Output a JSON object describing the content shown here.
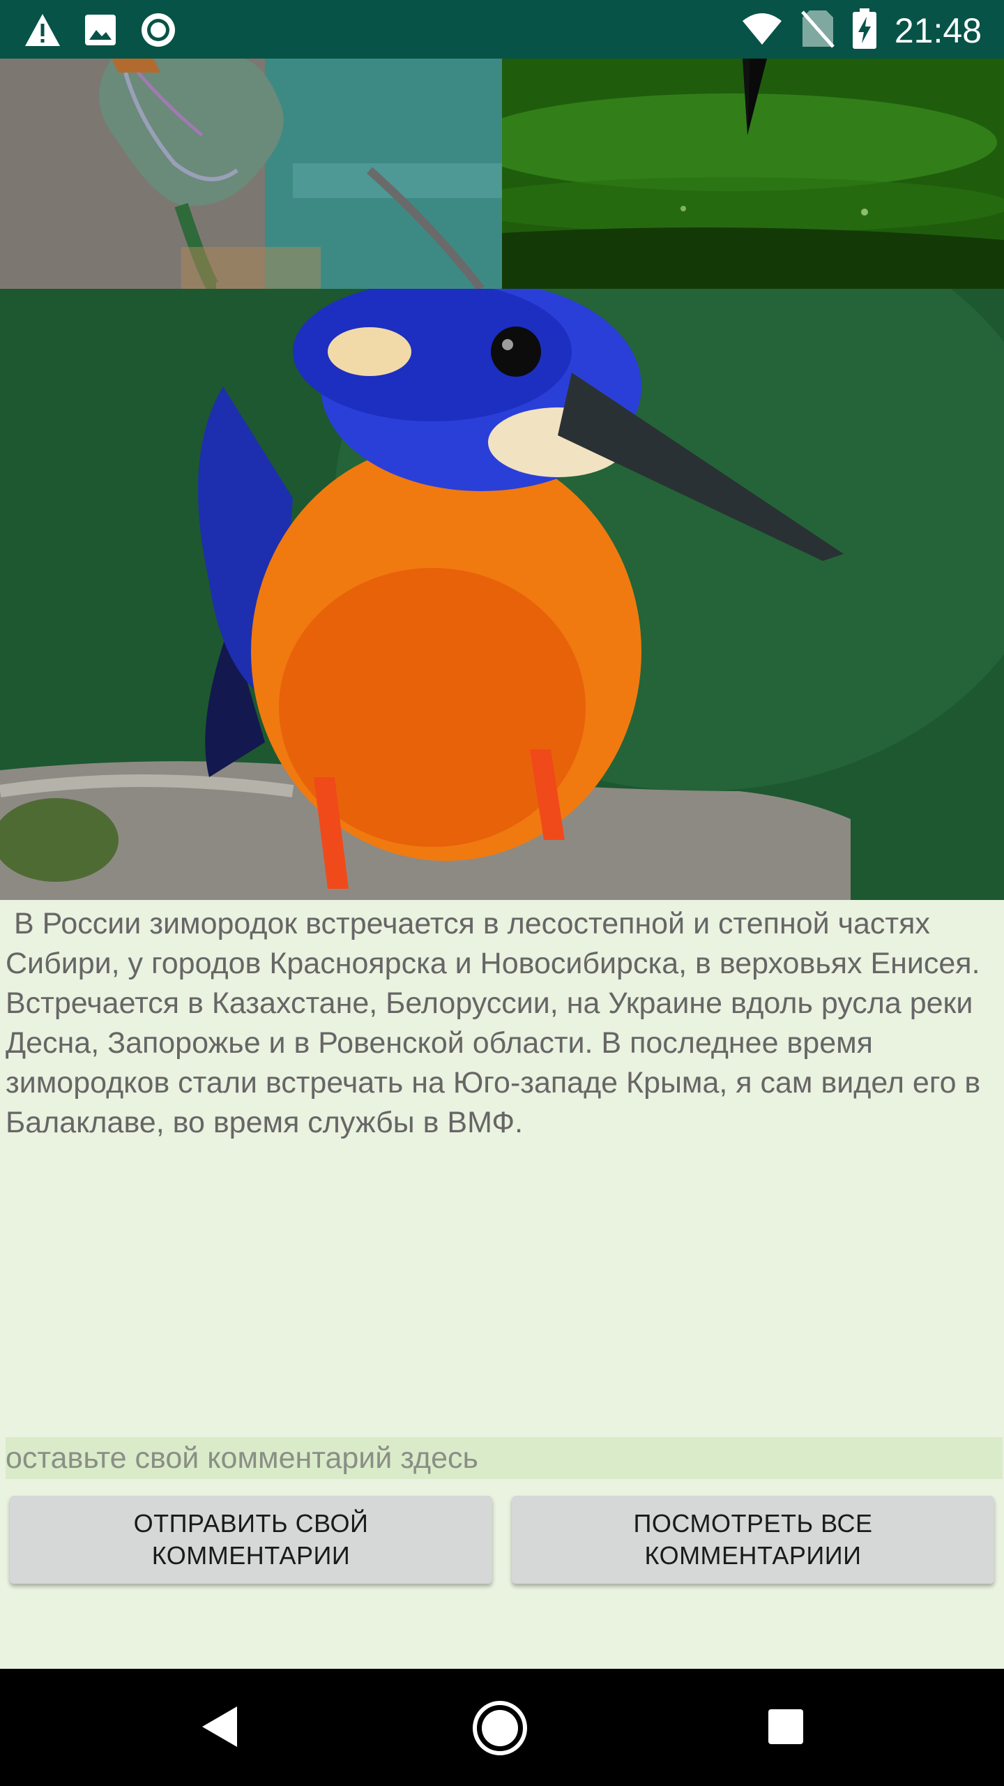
{
  "status_bar": {
    "time": "21:48",
    "icons_left": [
      "warning-icon",
      "image-icon",
      "sync-icon"
    ],
    "icons_right": [
      "wifi-icon",
      "no-sim-icon",
      "battery-charging-icon"
    ],
    "background_color": "#075347"
  },
  "images": {
    "top_left": "kingfisher-on-leaf-image",
    "top_right": "kingfisher-diving-water-image",
    "main": "kingfisher-on-branch-image"
  },
  "article": {
    "text": " В России зимородок встречается в лесостепной и степной частях Сибири, у городов Красноярска и Новосибирска, в верховьях Енисея. Встречается в Казахстане, Белоруссии, на Украине вдоль русла реки Десна, Запорожье и в Ровенской области. В последнее время зимородков стали встречать на Юго-западе Крыма, я сам видел его в Балаклаве, во время службы в ВМФ."
  },
  "comment": {
    "value": "",
    "placeholder": "оставьте свой комментарий здесь"
  },
  "buttons": {
    "send_label": "ОТПРАВИТЬ СВОЙ КОММЕНТАРИИ",
    "view_label": "ПОСМОТРЕТЬ ВСЕ КОММЕНТАРИИИ"
  },
  "nav_bar": {
    "icons": [
      "back-icon",
      "home-icon",
      "recents-icon"
    ]
  },
  "colors": {
    "background": "#eaf2e0",
    "input_background": "#d9ebc8",
    "button": "#d6d7d7"
  }
}
